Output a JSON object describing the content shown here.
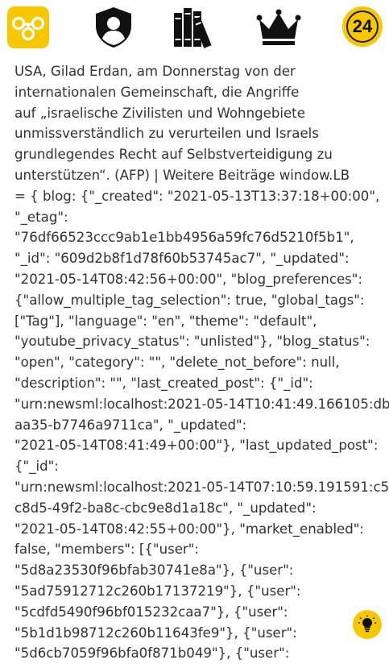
{
  "header": {
    "icons": [
      "app-logo-icon",
      "user-shield-icon",
      "books-icon",
      "crown-icon"
    ],
    "badge_count": "24",
    "accent_color": "#f7c800"
  },
  "article": {
    "lines": [
      "USA, Gilad Erdan, am Donnerstag von der",
      "internationalen Gemeinschaft, die Angriffe",
      "auf „israelische Zivilisten und Wohngebiete",
      "unmissverständlich zu verurteilen und Israels",
      "grundlegendes Recht auf Selbstverteidigung zu",
      "unterstützen“.  (AFP) | Weitere Beiträge window.LB",
      "= { blog: {\"_created\": \"2021-05-13T13:37:18+00:00\",",
      "\"_etag\":",
      "\"76df66523ccc9ab1e1bb4956a59fc76d5210f5b1\",",
      "\"_id\": \"609d2b8f1d78f60b53745ac7\", \"_updated\":",
      "\"2021-05-14T08:42:56+00:00\", \"blog_preferences\":",
      "{\"allow_multiple_tag_selection\": true, \"global_tags\":",
      "[\"Tag\"], \"language\": \"en\", \"theme\": \"default\",",
      "\"youtube_privacy_status\": \"unlisted\"}, \"blog_status\":",
      "\"open\", \"category\": \"\", \"delete_not_before\": null,",
      "\"description\": \"\", \"last_created_post\": {\"_id\":",
      "\"urn:newsml:localhost:2021-05-14T10:41:49.166105:db",
      "aa35-b7746a9711ca\", \"_updated\":",
      "\"2021-05-14T08:41:49+00:00\"}, \"last_updated_post\":",
      "{\"_id\":",
      "\"urn:newsml:localhost:2021-05-14T07:10:59.191591:c5",
      "c8d5-49f2-ba8c-cbc9e8d1a18c\", \"_updated\":",
      "\"2021-05-14T08:42:55+00:00\"}, \"market_enabled\":",
      "false, \"members\": [{\"user\":",
      "\"5d8a23530f96bfab30741e8a\"}, {\"user\":",
      "\"5ad75912712c260b17137219\"}, {\"user\":",
      "\"5cdfd5490f96bf015232caa7\"}, {\"user\":",
      "\"5b1d1b98712c260b11643fe9\"}, {\"user\":",
      "\"5d6cb7059f96bfa0f871b049\"}, {\"user\":"
    ]
  }
}
